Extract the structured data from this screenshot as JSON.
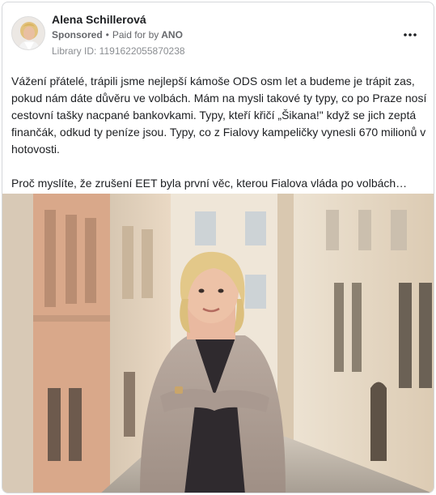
{
  "post": {
    "author": "Alena Schillerová",
    "sponsored_label": "Sponsored",
    "separator": "•",
    "paid_for_label": "Paid for by",
    "payer": "ANO",
    "library_id": "Library ID: 1191622055870238",
    "paragraphs": [
      "Vážení přátelé, trápili jsme nejlepší kámoše ODS osm let a budeme je trápit zas, pokud nám dáte důvěru ve volbách. Mám na mysli takové ty typy, co po Praze nosí cestovní tašky nacpané bankovkami. Typy, kteří křičí „Šikana!\" když se jich zeptá finančák, odkud ty peníze jsou. Typy, co z Fialovy kampeličky vynesli 670 milionů v hotovosti.",
      "Proč myslíte, že zrušení EET byla první věc, kterou Fialova vláda po volbách…"
    ]
  },
  "icons": {
    "more": "more-horizontal-icon",
    "avatar": "person-portrait",
    "photo": "woman-on-cobblestone-street"
  },
  "colors": {
    "text_primary": "#1c1e21",
    "text_secondary": "#65676b",
    "text_muted": "#8a8d91",
    "border": "#d5d7da"
  }
}
